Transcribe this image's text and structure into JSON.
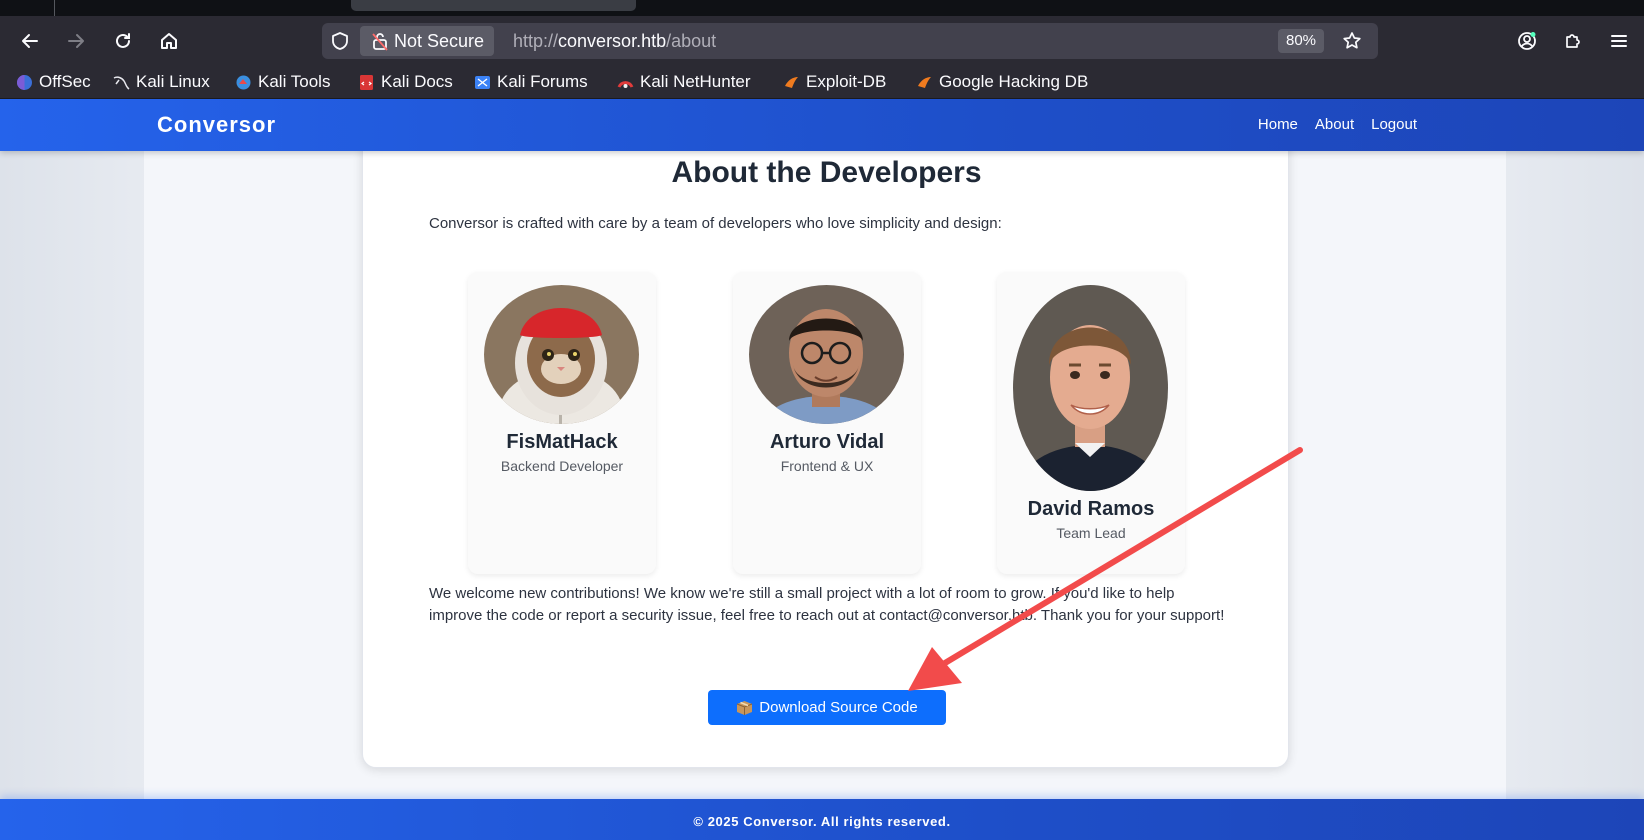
{
  "browser": {
    "url_security": "Not Secure",
    "url_scheme": "http://",
    "url_host": "conversor.htb",
    "url_path": "/about",
    "zoom": "80%",
    "bookmarks": [
      {
        "label": "OffSec",
        "icon": "offsec-icon"
      },
      {
        "label": "Kali Linux",
        "icon": "kali-dragon-icon"
      },
      {
        "label": "Kali Tools",
        "icon": "kali-tools-icon"
      },
      {
        "label": "Kali Docs",
        "icon": "kali-docs-icon"
      },
      {
        "label": "Kali Forums",
        "icon": "kali-forums-icon"
      },
      {
        "label": "Kali NetHunter",
        "icon": "nethunter-icon"
      },
      {
        "label": "Exploit-DB",
        "icon": "exploit-db-icon"
      },
      {
        "label": "Google Hacking DB",
        "icon": "ghdb-icon"
      }
    ]
  },
  "site": {
    "brand": "Conversor",
    "nav": [
      "Home",
      "About",
      "Logout"
    ],
    "title": "About the Developers",
    "intro": "Conversor is crafted with care by a team of developers who love simplicity and design:",
    "developers": [
      {
        "name": "FisMatHack",
        "role": "Backend Developer"
      },
      {
        "name": "Arturo Vidal",
        "role": "Frontend & UX"
      },
      {
        "name": "David Ramos",
        "role": "Team Lead"
      }
    ],
    "welcome": "We welcome new contributions! We know we're still a small project with a lot of room to grow. If you'd like to help improve the code or report a security issue, feel free to reach out at contact@conversor.htb. Thank you for your support!",
    "download_label": "Download Source Code",
    "footer": "© 2025 Conversor. All rights reserved."
  },
  "colors": {
    "primary": "#2563eb",
    "button": "#0d6efd",
    "annotation_arrow": "#f24b4b"
  }
}
